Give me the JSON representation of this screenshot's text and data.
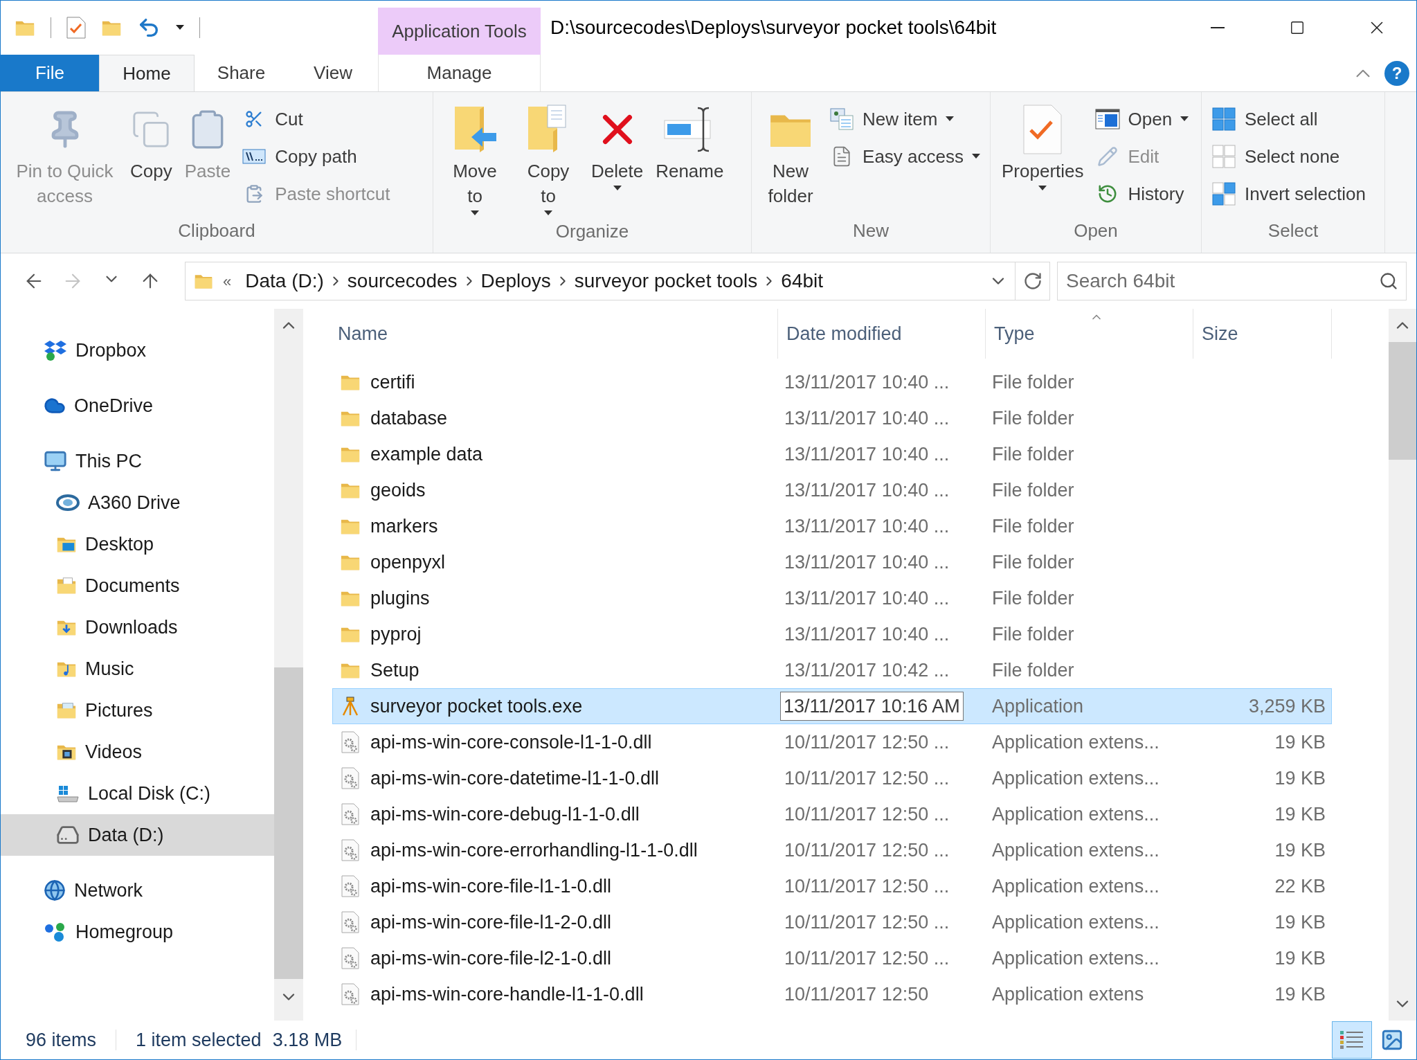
{
  "window": {
    "title": "D:\\sourcecodes\\Deploys\\surveyor pocket tools\\64bit"
  },
  "contextual_tab_group": {
    "label": "Application Tools"
  },
  "tabs": [
    {
      "label": "File",
      "kind": "file",
      "selected": false
    },
    {
      "label": "Home",
      "kind": "tab",
      "selected": true
    },
    {
      "label": "Share",
      "kind": "tab",
      "selected": false
    },
    {
      "label": "View",
      "kind": "tab",
      "selected": false
    },
    {
      "label": "Manage",
      "kind": "contextual",
      "selected": false
    }
  ],
  "help_button": "?",
  "ribbon": {
    "groups": [
      {
        "label": "Clipboard",
        "columns": [
          {
            "kind": "large",
            "buttons": [
              {
                "label": "Pin to Quick access",
                "disabled": true,
                "dropdown": false
              }
            ]
          },
          {
            "kind": "large",
            "buttons": [
              {
                "label": "Copy",
                "disabled": false,
                "dropdown": false
              }
            ]
          },
          {
            "kind": "large",
            "buttons": [
              {
                "label": "Paste",
                "disabled": true,
                "dropdown": false
              }
            ]
          },
          {
            "kind": "stack",
            "buttons": [
              {
                "label": "Cut",
                "disabled": false,
                "dropdown": false
              },
              {
                "label": "Copy path",
                "disabled": false,
                "dropdown": false
              },
              {
                "label": "Paste shortcut",
                "disabled": true,
                "dropdown": false
              }
            ]
          }
        ]
      },
      {
        "label": "Organize",
        "columns": [
          {
            "kind": "large",
            "buttons": [
              {
                "label": "Move to",
                "disabled": false,
                "dropdown": true
              }
            ]
          },
          {
            "kind": "large",
            "buttons": [
              {
                "label": "Copy to",
                "disabled": false,
                "dropdown": true
              }
            ]
          },
          {
            "kind": "large",
            "buttons": [
              {
                "label": "Delete",
                "disabled": false,
                "dropdown": true
              }
            ]
          },
          {
            "kind": "large",
            "buttons": [
              {
                "label": "Rename",
                "disabled": false,
                "dropdown": false
              }
            ]
          }
        ]
      },
      {
        "label": "New",
        "columns": [
          {
            "kind": "large",
            "buttons": [
              {
                "label": "New folder",
                "disabled": false,
                "dropdown": false
              }
            ]
          },
          {
            "kind": "stack",
            "buttons": [
              {
                "label": "New item",
                "disabled": false,
                "dropdown": true
              },
              {
                "label": "Easy access",
                "disabled": false,
                "dropdown": true
              }
            ]
          }
        ]
      },
      {
        "label": "Open",
        "columns": [
          {
            "kind": "large",
            "buttons": [
              {
                "label": "Properties",
                "disabled": false,
                "dropdown": true
              }
            ]
          },
          {
            "kind": "stack",
            "buttons": [
              {
                "label": "Open",
                "disabled": false,
                "dropdown": true
              },
              {
                "label": "Edit",
                "disabled": true,
                "dropdown": false
              },
              {
                "label": "History",
                "disabled": false,
                "dropdown": false
              }
            ]
          }
        ]
      },
      {
        "label": "Select",
        "columns": [
          {
            "kind": "stack",
            "buttons": [
              {
                "label": "Select all",
                "disabled": false,
                "dropdown": false
              },
              {
                "label": "Select none",
                "disabled": false,
                "dropdown": false
              },
              {
                "label": "Invert selection",
                "disabled": false,
                "dropdown": false
              }
            ]
          }
        ]
      }
    ]
  },
  "nav_buttons": [
    {
      "kind": "back",
      "disabled": false
    },
    {
      "kind": "forward",
      "disabled": true
    },
    {
      "kind": "recent",
      "disabled": false
    },
    {
      "kind": "up",
      "disabled": false
    }
  ],
  "address_bar": {
    "overflow": "«",
    "crumbs": [
      "Data (D:)",
      "sourcecodes",
      "Deploys",
      "surveyor pocket tools",
      "64bit"
    ]
  },
  "search": {
    "placeholder": "Search 64bit"
  },
  "sidebar": {
    "items": [
      {
        "label": "Dropbox",
        "selected": false
      },
      {
        "label": "OneDrive",
        "selected": false
      },
      {
        "label": "This PC",
        "selected": false,
        "children": [
          {
            "label": "A360 Drive",
            "selected": false
          },
          {
            "label": "Desktop",
            "selected": false
          },
          {
            "label": "Documents",
            "selected": false
          },
          {
            "label": "Downloads",
            "selected": false
          },
          {
            "label": "Music",
            "selected": false
          },
          {
            "label": "Pictures",
            "selected": false
          },
          {
            "label": "Videos",
            "selected": false
          },
          {
            "label": "Local Disk (C:)",
            "selected": false
          },
          {
            "label": "Data (D:)",
            "selected": true
          }
        ]
      },
      {
        "label": "Network",
        "selected": false
      },
      {
        "label": "Homegroup",
        "selected": false
      }
    ]
  },
  "file_list": {
    "columns": [
      {
        "label": "Name",
        "sorted": false
      },
      {
        "label": "Date modified",
        "sorted": false
      },
      {
        "label": "Type",
        "sorted": true
      },
      {
        "label": "Size",
        "sorted": false
      }
    ],
    "rows": [
      {
        "name": "certifi",
        "date": "13/11/2017 10:40 ...",
        "type": "File folder",
        "kind": "folder",
        "selected": false
      },
      {
        "name": "database",
        "date": "13/11/2017 10:40 ...",
        "type": "File folder",
        "kind": "folder",
        "selected": false
      },
      {
        "name": "example data",
        "date": "13/11/2017 10:40 ...",
        "type": "File folder",
        "kind": "folder",
        "selected": false
      },
      {
        "name": "geoids",
        "date": "13/11/2017 10:40 ...",
        "type": "File folder",
        "kind": "folder",
        "selected": false
      },
      {
        "name": "markers",
        "date": "13/11/2017 10:40 ...",
        "type": "File folder",
        "kind": "folder",
        "selected": false
      },
      {
        "name": "openpyxl",
        "date": "13/11/2017 10:40 ...",
        "type": "File folder",
        "kind": "folder",
        "selected": false
      },
      {
        "name": "plugins",
        "date": "13/11/2017 10:40 ...",
        "type": "File folder",
        "kind": "folder",
        "selected": false
      },
      {
        "name": "pyproj",
        "date": "13/11/2017 10:40 ...",
        "type": "File folder",
        "kind": "folder",
        "selected": false
      },
      {
        "name": "Setup",
        "date": "13/11/2017 10:42 ...",
        "type": "File folder",
        "kind": "folder",
        "selected": false
      },
      {
        "name": "surveyor pocket tools.exe",
        "date": "13/11/2017 10:16 AM",
        "date_tooltip": true,
        "type": "Application",
        "size": "3,259 KB",
        "kind": "application",
        "selected": true
      },
      {
        "name": "api-ms-win-core-console-l1-1-0.dll",
        "date": "10/11/2017 12:50 ...",
        "type": "Application extens...",
        "size": "19 KB",
        "kind": "extension",
        "selected": false
      },
      {
        "name": "api-ms-win-core-datetime-l1-1-0.dll",
        "date": "10/11/2017 12:50 ...",
        "type": "Application extens...",
        "size": "19 KB",
        "kind": "extension",
        "selected": false
      },
      {
        "name": "api-ms-win-core-debug-l1-1-0.dll",
        "date": "10/11/2017 12:50 ...",
        "type": "Application extens...",
        "size": "19 KB",
        "kind": "extension",
        "selected": false
      },
      {
        "name": "api-ms-win-core-errorhandling-l1-1-0.dll",
        "date": "10/11/2017 12:50 ...",
        "type": "Application extens...",
        "size": "19 KB",
        "kind": "extension",
        "selected": false
      },
      {
        "name": "api-ms-win-core-file-l1-1-0.dll",
        "date": "10/11/2017 12:50 ...",
        "type": "Application extens...",
        "size": "22 KB",
        "kind": "extension",
        "selected": false
      },
      {
        "name": "api-ms-win-core-file-l1-2-0.dll",
        "date": "10/11/2017 12:50 ...",
        "type": "Application extens...",
        "size": "19 KB",
        "kind": "extension",
        "selected": false
      },
      {
        "name": "api-ms-win-core-file-l2-1-0.dll",
        "date": "10/11/2017 12:50 ...",
        "type": "Application extens...",
        "size": "19 KB",
        "kind": "extension",
        "selected": false
      },
      {
        "name": "api-ms-win-core-handle-l1-1-0.dll",
        "date": "10/11/2017 12:50",
        "type": "Application extens",
        "size": "19 KB",
        "kind": "extension",
        "selected": false
      }
    ]
  },
  "status_bar": {
    "item_count": "96 items",
    "selection": "1 item selected",
    "selection_size": "3.18 MB"
  },
  "view_buttons": [
    {
      "kind": "details",
      "selected": true
    },
    {
      "kind": "large-icons",
      "selected": false
    }
  ]
}
